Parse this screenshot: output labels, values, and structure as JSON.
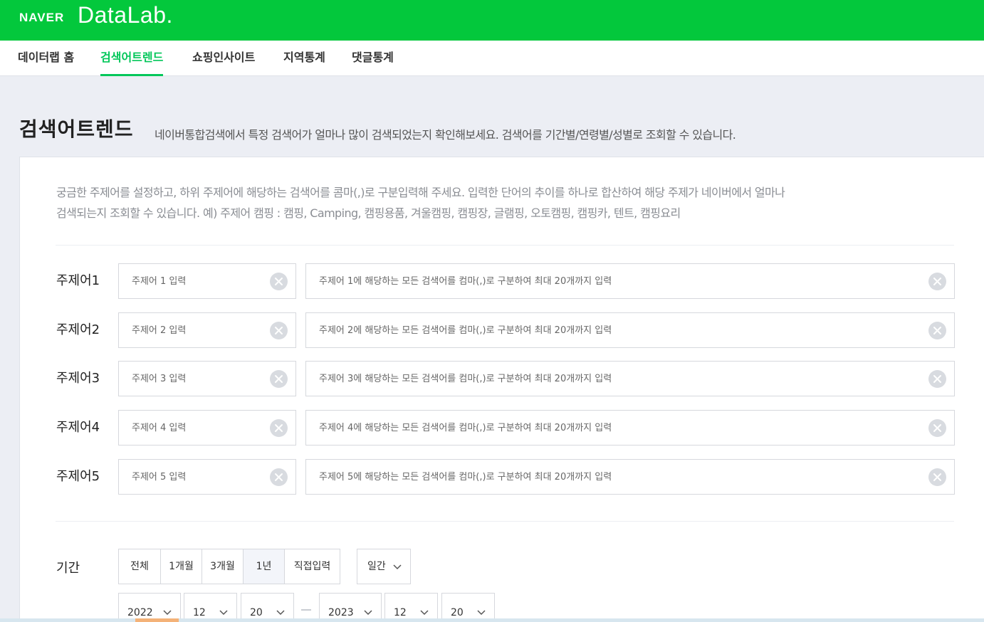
{
  "header": {
    "brand_naver": "NAVER",
    "brand_datalab": "DataLab."
  },
  "nav": {
    "items": [
      {
        "label": "데이터랩 홈"
      },
      {
        "label": "검색어트렌드"
      },
      {
        "label": "쇼핑인사이트"
      },
      {
        "label": "지역통계"
      },
      {
        "label": "댓글통계"
      }
    ],
    "active_index": 1
  },
  "page": {
    "title": "검색어트렌드",
    "description": "네이버통합검색에서 특정 검색어가 얼마나 많이 검색되었는지 확인해보세요. 검색어를 기간별/연령별/성별로 조회할 수 있습니다."
  },
  "guide": {
    "line1": "궁금한 주제어를 설정하고, 하위 주제어에 해당하는 검색어를 콤마(,)로 구분입력해 주세요. 입력한 단어의 추이를 하나로 합산하여 해당 주제가 네이버에서 얼마나",
    "line2": "검색되는지 조회할 수 있습니다. 예) 주제어 캠핑 : 캠핑, Camping, 캠핑용품, 겨울캠핑, 캠핑장, 글램핑, 오토캠핑, 캠핑카, 텐트, 캠핑요리"
  },
  "topics": [
    {
      "label": "주제어1",
      "name_placeholder": "주제어 1 입력",
      "keywords_placeholder": "주제어 1에 해당하는 모든 검색어를 컴마(,)로 구분하여 최대 20개까지 입력"
    },
    {
      "label": "주제어2",
      "name_placeholder": "주제어 2 입력",
      "keywords_placeholder": "주제어 2에 해당하는 모든 검색어를 컴마(,)로 구분하여 최대 20개까지 입력"
    },
    {
      "label": "주제어3",
      "name_placeholder": "주제어 3 입력",
      "keywords_placeholder": "주제어 3에 해당하는 모든 검색어를 컴마(,)로 구분하여 최대 20개까지 입력"
    },
    {
      "label": "주제어4",
      "name_placeholder": "주제어 4 입력",
      "keywords_placeholder": "주제어 4에 해당하는 모든 검색어를 컴마(,)로 구분하여 최대 20개까지 입력"
    },
    {
      "label": "주제어5",
      "name_placeholder": "주제어 5 입력",
      "keywords_placeholder": "주제어 5에 해당하는 모든 검색어를 컴마(,)로 구분하여 최대 20개까지 입력"
    }
  ],
  "period": {
    "label": "기간",
    "options": [
      "전체",
      "1개월",
      "3개월",
      "1년",
      "직접입력"
    ],
    "selected": "1년",
    "time_unit": "일간",
    "start": {
      "year": "2022",
      "month": "12",
      "day": "20"
    },
    "end": {
      "year": "2023",
      "month": "12",
      "day": "20"
    }
  },
  "colors": {
    "brand_green": "#03c83c",
    "active_tab": "#03c75a"
  },
  "icons": {
    "clear": "clear-circle-icon",
    "dropdown": "chevron-down-icon"
  }
}
